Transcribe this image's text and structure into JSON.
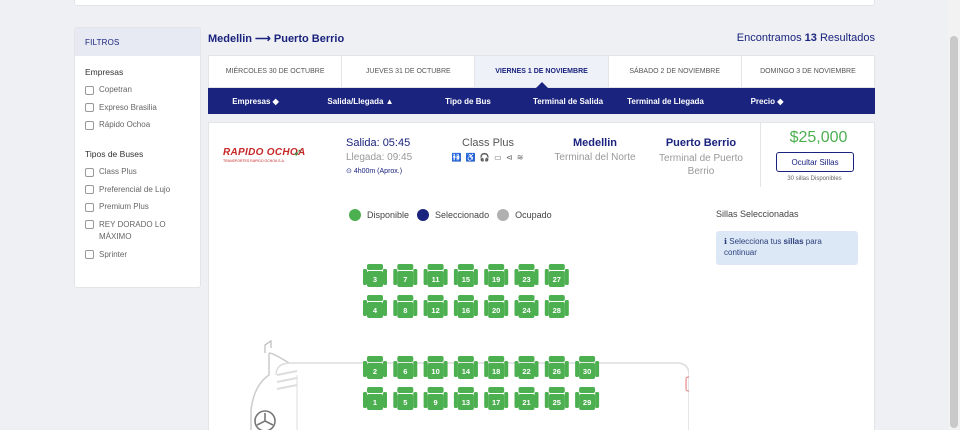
{
  "sidebar": {
    "header": "FILTROS",
    "companies_title": "Empresas",
    "companies": [
      "Copetran",
      "Expreso Brasilia",
      "Rápido Ochoa"
    ],
    "bus_types_title": "Tipos de Buses",
    "bus_types": [
      "Class Plus",
      "Preferencial de Lujo",
      "Premium Plus",
      "REY DORADO LO MÁXIMO",
      "Sprinter"
    ]
  },
  "header": {
    "route": "Medellin ⟶ Puerto Berrio",
    "results_prefix": "Encontramos",
    "results_count": "13",
    "results_suffix": "Resultados"
  },
  "dates": [
    {
      "label": "MIÉRCOLES 30 DE OCTUBRE",
      "active": false
    },
    {
      "label": "JUEVES 31 DE OCTUBRE",
      "active": false
    },
    {
      "label": "VIERNES 1 DE NOVIEMBRE",
      "active": true
    },
    {
      "label": "SÁBADO 2 DE NOVIEMBRE",
      "active": false
    },
    {
      "label": "DOMINGO 3 DE NOVIEMBRE",
      "active": false
    }
  ],
  "columns": [
    {
      "label": "Empresas ◆"
    },
    {
      "label": "Salida/Llegada ▲"
    },
    {
      "label": "Tipo de Bus"
    },
    {
      "label": "Terminal de Salida"
    },
    {
      "label": "Terminal de Llegada"
    },
    {
      "label": "Precio ◆"
    }
  ],
  "trip": {
    "company_logo_text": "RAPIDO OCHOA",
    "company_logo_sub": "TRANSPORTES RAPIDO OCHOA S.A.",
    "departure": "Salida: 05:45",
    "arrival": "Llegada: 09:45",
    "duration": "4h00m (Aprox.)",
    "bus_type": "Class Plus",
    "amenities": "🚻 ♿ 🎧 ▭ ⊲ ≋",
    "origin": "Medellin",
    "origin_terminal": "Terminal del Norte",
    "destination": "Puerto Berrio",
    "destination_terminal": "Terminal de Puerto Berrio",
    "price": "$25,000",
    "hide_seats_label": "Ocultar Sillas",
    "available_seats": "30 sillas Disponibles"
  },
  "legend": {
    "available": "Disponible",
    "selected": "Seleccionado",
    "occupied": "Ocupado"
  },
  "selection": {
    "title": "Sillas Seleccionadas",
    "info_prefix": "Selecciona tus",
    "info_bold": "sillas",
    "info_suffix": "para continuar"
  },
  "seats": {
    "row_window_left": [
      "3",
      "7",
      "11",
      "15",
      "19",
      "23",
      "27"
    ],
    "row_aisle_left": [
      "4",
      "8",
      "12",
      "16",
      "20",
      "24",
      "28"
    ],
    "row_aisle_right": [
      "2",
      "6",
      "10",
      "14",
      "18",
      "22",
      "26",
      "30"
    ],
    "row_window_right": [
      "1",
      "5",
      "9",
      "13",
      "17",
      "21",
      "25",
      "29"
    ]
  },
  "colors": {
    "primary": "#1a237e",
    "available": "#4caf50",
    "selected": "#1a237e",
    "occupied": "#b0b0b0",
    "price": "#4caf50"
  }
}
